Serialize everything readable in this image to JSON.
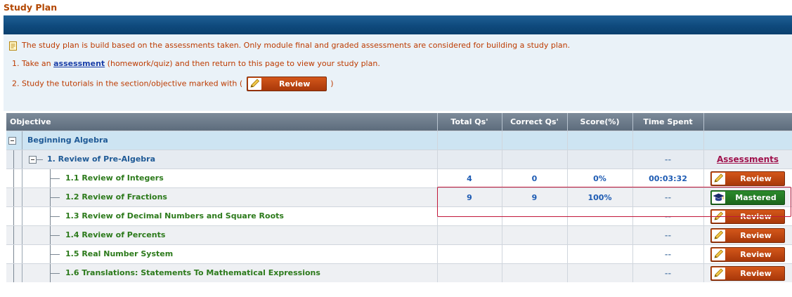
{
  "page": {
    "title": "Study Plan"
  },
  "info": {
    "note": "The study plan is build based on the assessments taken. Only module final and graded assessments are considered for building a study plan.",
    "step1": {
      "prefix": "1. Take an ",
      "link": "assessment",
      "suffix": " (homework/quiz) and then return to this page to view your study plan."
    },
    "step2": {
      "prefix": "2. Study the tutorials in the section/objective marked with (",
      "button": "Review",
      "suffix": ")"
    }
  },
  "table": {
    "headers": {
      "objective": "Objective",
      "total": "Total Qs'",
      "correct": "Correct Qs'",
      "score": "Score(%)",
      "time": "Time Spent"
    },
    "rows": [
      {
        "name": "Beginning Algebra",
        "total": "",
        "correct": "",
        "score": "",
        "time": "",
        "action": ""
      },
      {
        "name": "1. Review of Pre-Algebra",
        "total": "",
        "correct": "",
        "score": "",
        "time": "--",
        "action": "Assessments"
      },
      {
        "name": "1.1 Review of Integers",
        "total": "4",
        "correct": "0",
        "score": "0%",
        "time": "00:03:32",
        "action": "Review"
      },
      {
        "name": "1.2 Review of Fractions",
        "total": "9",
        "correct": "9",
        "score": "100%",
        "time": "--",
        "action": "Mastered"
      },
      {
        "name": "1.3 Review of Decimal Numbers and Square Roots",
        "total": "",
        "correct": "",
        "score": "",
        "time": "--",
        "action": "Review"
      },
      {
        "name": "1.4 Review of Percents",
        "total": "",
        "correct": "",
        "score": "",
        "time": "--",
        "action": "Review"
      },
      {
        "name": "1.5 Real Number System",
        "total": "",
        "correct": "",
        "score": "",
        "time": "--",
        "action": "Review"
      },
      {
        "name": "1.6 Translations: Statements To Mathematical Expressions",
        "total": "",
        "correct": "",
        "score": "",
        "time": "--",
        "action": "Review"
      }
    ]
  },
  "colors": {
    "title": "#b34700",
    "header_bar": "#0f4a7d",
    "review_button": "#c04a12",
    "mastered_button": "#237623",
    "highlight": "#c2183a"
  },
  "icons": {
    "note": "note-icon",
    "review": "pencil-icon",
    "mastered": "graduation-cap-icon"
  }
}
